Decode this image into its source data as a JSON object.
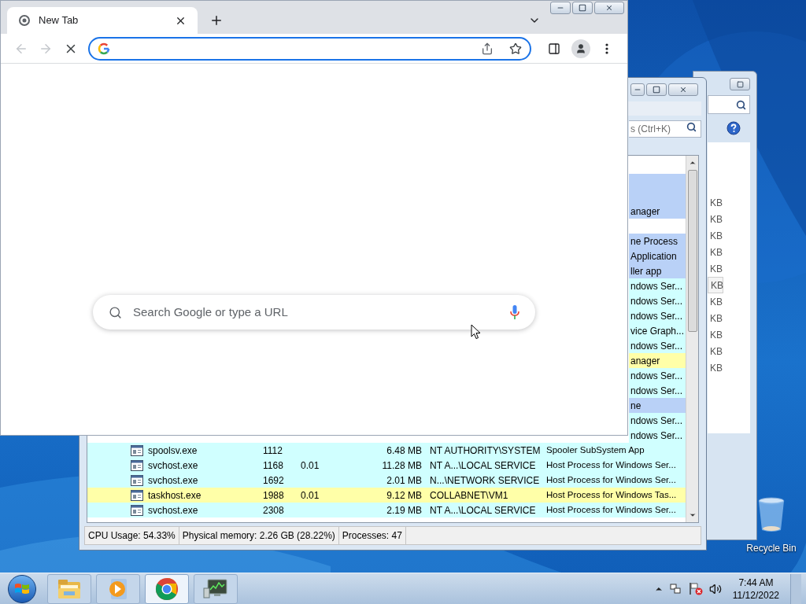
{
  "browser": {
    "tab": {
      "title": "New Tab",
      "selected": true
    },
    "back_disabled": true,
    "forward_disabled": true,
    "search_placeholder": "Search Google or type a URL"
  },
  "process_window": {
    "search_placeholder": "s (Ctrl+K)",
    "rows": [
      {
        "kind": "covered",
        "color": "#b9d1f7"
      },
      {
        "kind": "covered",
        "color": "#b9d1f7"
      },
      {
        "kind": "covered",
        "color": "#b9d1f7",
        "description": "anager"
      },
      {
        "kind": "covered",
        "color": "#ffffff"
      },
      {
        "kind": "covered",
        "color": "#b9d1f7",
        "description": "ne Process"
      },
      {
        "kind": "covered",
        "color": "#b9d1f7",
        "description": "Application"
      },
      {
        "kind": "covered",
        "color": "#b9d1f7",
        "description": "ller app"
      },
      {
        "kind": "covered",
        "color": "#d0ffff",
        "description": "ndows Ser..."
      },
      {
        "kind": "covered",
        "color": "#d0ffff",
        "description": "ndows Ser..."
      },
      {
        "kind": "covered",
        "color": "#d0ffff",
        "description": "ndows Ser..."
      },
      {
        "kind": "covered",
        "color": "#d0ffff",
        "description": "vice Graph..."
      },
      {
        "kind": "covered",
        "color": "#d0ffff",
        "description": "ndows Ser..."
      },
      {
        "kind": "covered",
        "color": "#ffffa8",
        "description": "anager"
      },
      {
        "kind": "covered",
        "color": "#d0ffff",
        "description": "ndows Ser..."
      },
      {
        "kind": "covered",
        "color": "#d0ffff",
        "description": "ndows Ser..."
      },
      {
        "kind": "covered",
        "color": "#b9d1f7",
        "description": "ne"
      },
      {
        "kind": "covered",
        "color": "#d0ffff",
        "description": "ndows Ser..."
      },
      {
        "kind": "covered",
        "color": "#d0ffff",
        "description": "ndows Ser..."
      },
      {
        "kind": "full",
        "color": "#d0ffff",
        "name": "spoolsv.exe",
        "pid": "1112",
        "private_bytes": "6.48 MB",
        "user": "NT AUTHORITY\\SYSTEM",
        "description": "Spooler SubSystem App"
      },
      {
        "kind": "full",
        "color": "#d0ffff",
        "name": "svchost.exe",
        "pid": "1168",
        "cpu": "0.01",
        "private_bytes": "11.28 MB",
        "user": "NT A...\\LOCAL SERVICE",
        "description": "Host Process for Windows Ser..."
      },
      {
        "kind": "full",
        "color": "#d0ffff",
        "name": "svchost.exe",
        "pid": "1692",
        "private_bytes": "2.01 MB",
        "user": "N...\\NETWORK SERVICE",
        "description": "Host Process for Windows Ser..."
      },
      {
        "kind": "full",
        "color": "#ffffa8",
        "name": "taskhost.exe",
        "pid": "1988",
        "cpu": "0.01",
        "private_bytes": "9.12 MB",
        "user": "COLLABNET\\VM1",
        "description": "Host Process for Windows Tas..."
      },
      {
        "kind": "full",
        "color": "#d0ffff",
        "name": "svchost.exe",
        "pid": "2308",
        "private_bytes": "2.19 MB",
        "user": "NT A...\\LOCAL SERVICE",
        "description": "Host Process for Windows Ser..."
      }
    ],
    "status": [
      "CPU Usage: 54.33%",
      "Physical memory: 2.26 GB (28.22%)",
      "Processes: 47"
    ]
  },
  "back_window": {
    "cells": [
      {
        "text": "KB",
        "selected": false
      },
      {
        "text": "KB",
        "selected": false
      },
      {
        "text": "KB",
        "selected": false
      },
      {
        "text": "KB",
        "selected": false
      },
      {
        "text": "KB",
        "selected": false
      },
      {
        "text": "KB",
        "selected": true
      },
      {
        "text": "KB",
        "selected": false
      },
      {
        "text": "KB",
        "selected": false
      },
      {
        "text": "KB",
        "selected": false
      },
      {
        "text": "KB",
        "selected": false
      },
      {
        "text": "KB",
        "selected": false
      }
    ]
  },
  "desktop_icons": [
    {
      "label": "Recycle Bin"
    }
  ],
  "taskbar": {
    "items": [
      {
        "kind": "explorer",
        "selected": false
      },
      {
        "kind": "media",
        "selected": false
      },
      {
        "kind": "chrome",
        "selected": true
      },
      {
        "kind": "monitor",
        "selected": false
      }
    ],
    "time": "7:44 AM",
    "date": "11/12/2022"
  }
}
